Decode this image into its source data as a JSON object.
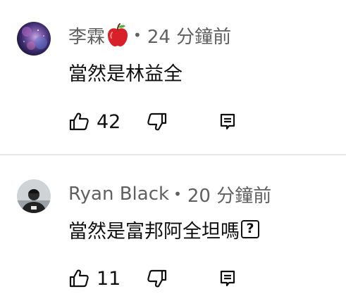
{
  "comments": [
    {
      "author": "李霖",
      "author_emoji": "apple-emoji",
      "separator": "•",
      "time": "24 分鐘前",
      "text": "當然是林益全",
      "likes": "42"
    },
    {
      "author": "Ryan Black",
      "separator": "•",
      "time": "20 分鐘前",
      "text": "當然是富邦阿全坦嗎",
      "text_suffix_glyph": "?",
      "likes": "11"
    }
  ],
  "icons": {
    "like": "thumbs-up-icon",
    "dislike": "thumbs-down-icon",
    "reply": "reply-comment-icon"
  },
  "colors": {
    "text_primary": "#0f0f0f",
    "text_secondary": "#606060",
    "divider": "#e5e5e5"
  }
}
